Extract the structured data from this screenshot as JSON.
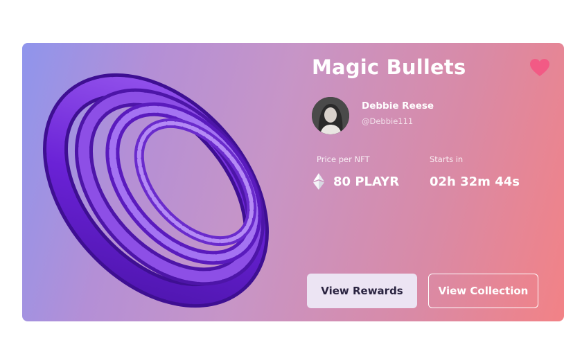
{
  "nft": {
    "title": "Magic Bullets",
    "favorite": true
  },
  "creator": {
    "name": "Debbie Reese",
    "handle": "@Debbie111"
  },
  "price": {
    "label": "Price per NFT",
    "value": "80 PLAYR",
    "currency_icon": "ethereum-icon"
  },
  "auction": {
    "label": "Starts in",
    "value": "02h 32m 44s"
  },
  "actions": {
    "rewards_label": "View Rewards",
    "collection_label": "View Collection"
  },
  "colors": {
    "gradient_start": "#8f95ec",
    "gradient_end": "#f28286",
    "heart": "#f25a85",
    "artwork_purple": "#6a22d6"
  }
}
